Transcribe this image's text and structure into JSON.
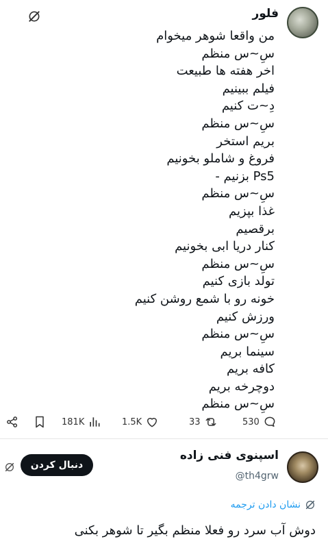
{
  "tweet": {
    "author_name": "فلور",
    "lines": [
      "من واقعا شوهر میخوام",
      "سِ~س منظم",
      "اخر هفته ها طبیعت",
      "فیلم ببینیم",
      "دِ~ت کنیم",
      "سِ~س منظم",
      "بریم استخر",
      "فروغ و شاملو بخونیم",
      "Ps5 بزنیم -",
      "سِ~س منظم",
      "غذا بپزیم",
      "برقصیم",
      "کنار دریا ابی بخونیم",
      "سِ~س منظم",
      "تولد بازی کنیم",
      "خونه رو با شمع روشن کنیم",
      "ورزش کنیم",
      "سِ~س منظم",
      "سینما بریم",
      "کافه بریم",
      "دوچرخه بریم",
      "سِ~س منظم"
    ],
    "actions": {
      "views": "181K",
      "likes": "1.5K",
      "retweets": "33",
      "replies": "530"
    }
  },
  "reply": {
    "author_name": "اسپنوی فنی زاده",
    "handle": "@th4grw",
    "follow_label": "دنبال کردن",
    "translate_label": "نشان دادن ترجمه",
    "text": "دوش آب سرد رو فعلا منظم بگیر تا شوهر بکنی"
  },
  "colors": {
    "accent": "#1d9bf0",
    "text": "#0f1419",
    "muted": "#536471"
  },
  "icons": {
    "share": "share-icon",
    "bookmark": "bookmark-icon",
    "views": "views-icon",
    "like": "heart-icon",
    "retweet": "retweet-icon",
    "reply": "reply-icon",
    "grok": "grok-icon",
    "translate": "translate-icon"
  }
}
